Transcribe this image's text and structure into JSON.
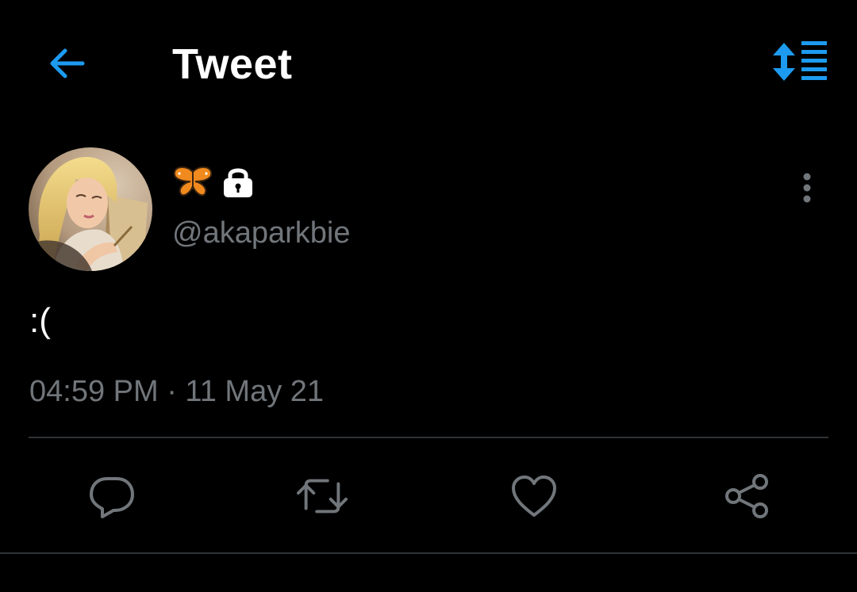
{
  "header": {
    "title": "Tweet",
    "back_icon": "arrow-left-icon",
    "sort_icon": "sort-replies-icon",
    "accent_color": "#1d9bf0"
  },
  "tweet": {
    "author": {
      "display_name_emoji": "🦋",
      "protected_icon": "lock-icon",
      "handle": "@akaparkbie",
      "avatar": "avatar"
    },
    "text": ":(",
    "timestamp": "04:59 PM · 11 May 21",
    "more_icon": "more-vertical-icon"
  },
  "actions": [
    {
      "name": "reply",
      "icon": "reply-icon"
    },
    {
      "name": "retweet",
      "icon": "retweet-icon"
    },
    {
      "name": "like",
      "icon": "heart-icon"
    },
    {
      "name": "share",
      "icon": "share-icon"
    }
  ],
  "colors": {
    "background": "#000000",
    "text": "#ffffff",
    "muted": "#71767b",
    "divider": "#2f3336",
    "accent": "#1d9bf0"
  }
}
